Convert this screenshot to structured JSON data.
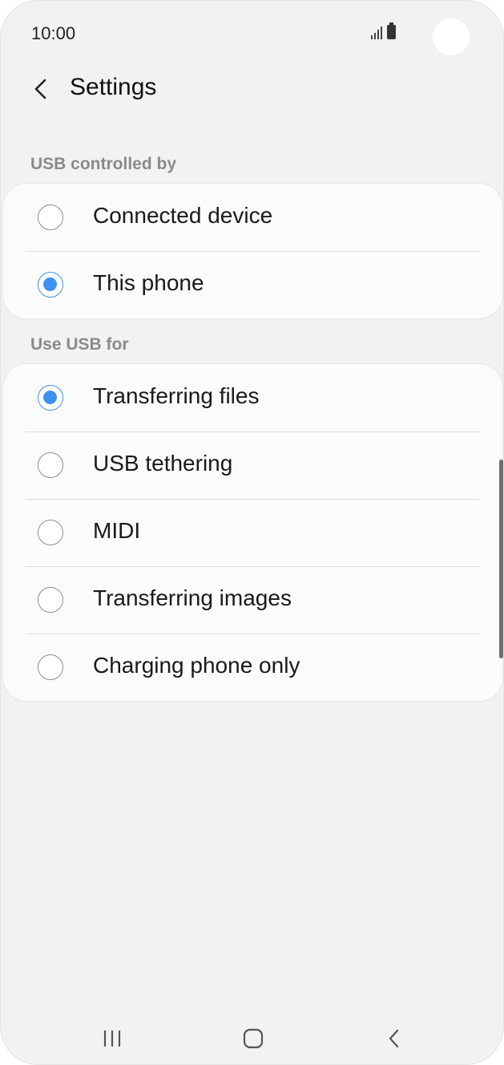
{
  "status_bar": {
    "time": "10:00",
    "icons": [
      "signal-icon",
      "battery-icon"
    ]
  },
  "header": {
    "back_icon": "chevron-left-icon",
    "title": "Settings"
  },
  "usb_controlled_by": {
    "label": "USB controlled by",
    "options": [
      {
        "label": "Connected device",
        "selected": false
      },
      {
        "label": "This phone",
        "selected": true
      }
    ]
  },
  "use_usb_for": {
    "label": "Use USB for",
    "options": [
      {
        "label": "Transferring files",
        "selected": true
      },
      {
        "label": "USB tethering",
        "selected": false
      },
      {
        "label": "MIDI",
        "selected": false
      },
      {
        "label": "Transferring images",
        "selected": false
      },
      {
        "label": "Charging phone only",
        "selected": false
      }
    ]
  },
  "navigation": {
    "buttons": [
      "recent-apps-icon",
      "home-icon",
      "back-icon"
    ]
  },
  "colors": {
    "accent": "#3e91f2",
    "background": "#f2f2f2",
    "card": "#fbfbfb"
  }
}
